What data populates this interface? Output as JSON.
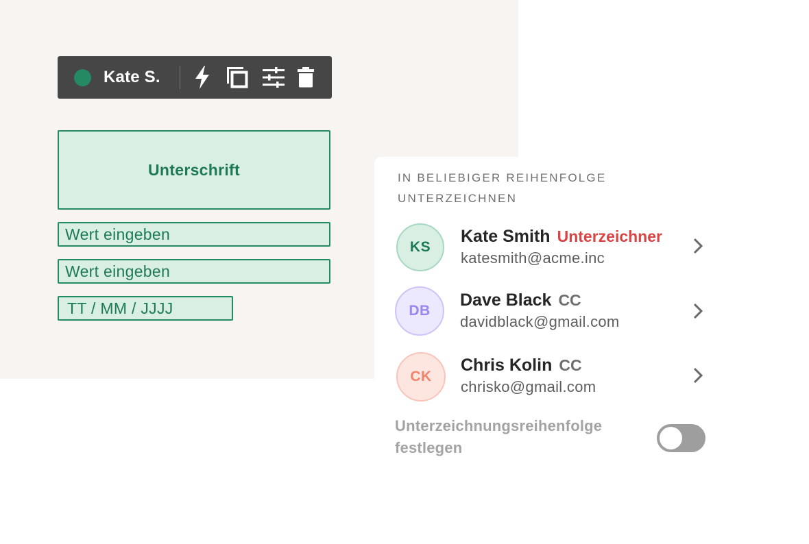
{
  "toolbar": {
    "user_name": "Kate S.",
    "status_color": "#238a63",
    "icons": [
      "lightning-icon",
      "copy-icon",
      "sliders-icon",
      "trash-icon"
    ]
  },
  "fields": {
    "signature_label": "Unterschrift",
    "text1_placeholder": "Wert eingeben",
    "text2_placeholder": "Wert eingeben",
    "date_placeholder": "TT / MM / JJJJ"
  },
  "panel": {
    "heading": "IN BELIEBIGER REIHENFOLGE UNTERZEICHNEN",
    "recipients": [
      {
        "initials": "KS",
        "name": "Kate Smith",
        "role": "Unterzeichner",
        "email": "katesmith@acme.inc",
        "role_color": "#d94444",
        "avatar_color": "#1d7a55"
      },
      {
        "initials": "DB",
        "name": "Dave Black",
        "role": "CC",
        "email": "davidblack@gmail.com",
        "role_color": "#6e6e6e",
        "avatar_color": "#9b86f0"
      },
      {
        "initials": "CK",
        "name": "Chris Kolin",
        "role": "CC",
        "email": "chrisko@gmail.com",
        "role_color": "#6e6e6e",
        "avatar_color": "#f0836a"
      }
    ],
    "order_label": "Unterzeichnungsreihenfolge festlegen",
    "order_toggle_on": false
  }
}
